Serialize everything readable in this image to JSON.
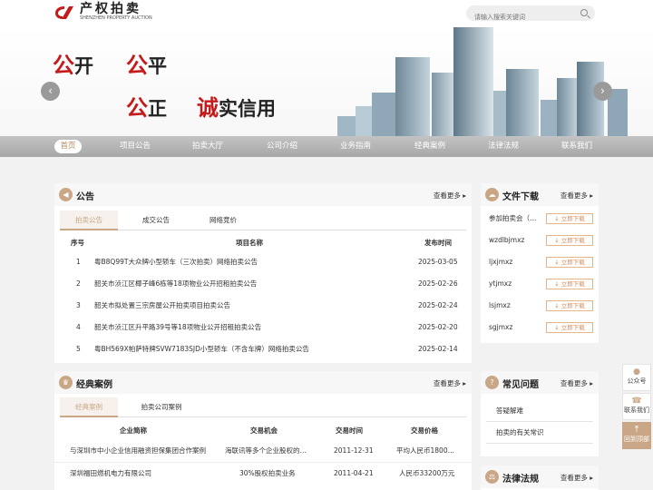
{
  "logo": {
    "cn": "产权拍卖",
    "en": "SHENZHEN PROPERTY AUCTION"
  },
  "search": {
    "placeholder": "请输入搜索关键词"
  },
  "banner": {
    "s1a": "公",
    "s1b": "开",
    "s2a": "公",
    "s2b": "平",
    "s3a": "公",
    "s3b": "正",
    "s4a": "诚",
    "s4b": "实信用",
    "prev": "‹",
    "next": "›"
  },
  "nav": [
    "首页",
    "项目公告",
    "拍卖大厅",
    "公司介绍",
    "业务指南",
    "经典案例",
    "法律法规",
    "联系我们"
  ],
  "notice": {
    "title": "公告",
    "more": "查看更多",
    "tabs": [
      "拍卖公告",
      "成交公告",
      "网络竞价"
    ],
    "headers": [
      "序号",
      "项目名称",
      "发布时间"
    ],
    "rows": [
      {
        "no": "1",
        "name": "粤B8Q99T大众牌小型轿车（三次拍卖）网络拍卖公告",
        "date": "2025-03-05"
      },
      {
        "no": "2",
        "name": "韶关市浈江区椰子峰6栋等18项物业公开招租拍卖公告",
        "date": "2025-02-26"
      },
      {
        "no": "3",
        "name": "韶关市拟处置三宗房屋公开拍卖项目拍卖公告",
        "date": "2025-02-24"
      },
      {
        "no": "4",
        "name": "韶关市浈江区升平路39号等18项物业公开招租拍卖公告",
        "date": "2025-02-20"
      },
      {
        "no": "5",
        "name": "粤BH569X帕萨特牌SVW7183SJD小型轿车（不含车牌）网络拍卖公告",
        "date": "2025-02-14"
      }
    ]
  },
  "download": {
    "title": "文件下载",
    "more": "查看更多",
    "btn": "↓ 立即下载",
    "items": [
      "参加拍卖会（…",
      "wzdlbjmxz",
      "ljxjmxz",
      "ytjmxz",
      "lsjmxz",
      "sgjmxz"
    ]
  },
  "cases": {
    "title": "经典案例",
    "more": "查看更多",
    "tabs": [
      "经典案例",
      "拍卖公司案例"
    ],
    "headers": [
      "企业简称",
      "交易机会",
      "交易时间",
      "交易价格"
    ],
    "rows": [
      {
        "c": "与深圳市中小企业信用融资担保集团合作案例",
        "o": "海联讯等多个企业股权的…",
        "t": "2011-12-31",
        "p": "平均人民币1800…"
      },
      {
        "c": "深圳福田燃机电力有限公司",
        "o": "30%股权拍卖业务",
        "t": "2011-04-21",
        "p": "人民币33200万元"
      }
    ]
  },
  "faq": {
    "title": "常见问题",
    "more": "查看更多",
    "items": [
      "答疑解难",
      "拍卖的有关常识"
    ]
  },
  "law": {
    "title": "法律法规",
    "more": "查看更多"
  },
  "side": {
    "wechat": "公众号",
    "contact": "联系我们",
    "top": "回到顶部"
  },
  "colors": {
    "accent": "#c9a786",
    "red": "#c41a1a",
    "nav": "#b0b0b0"
  }
}
